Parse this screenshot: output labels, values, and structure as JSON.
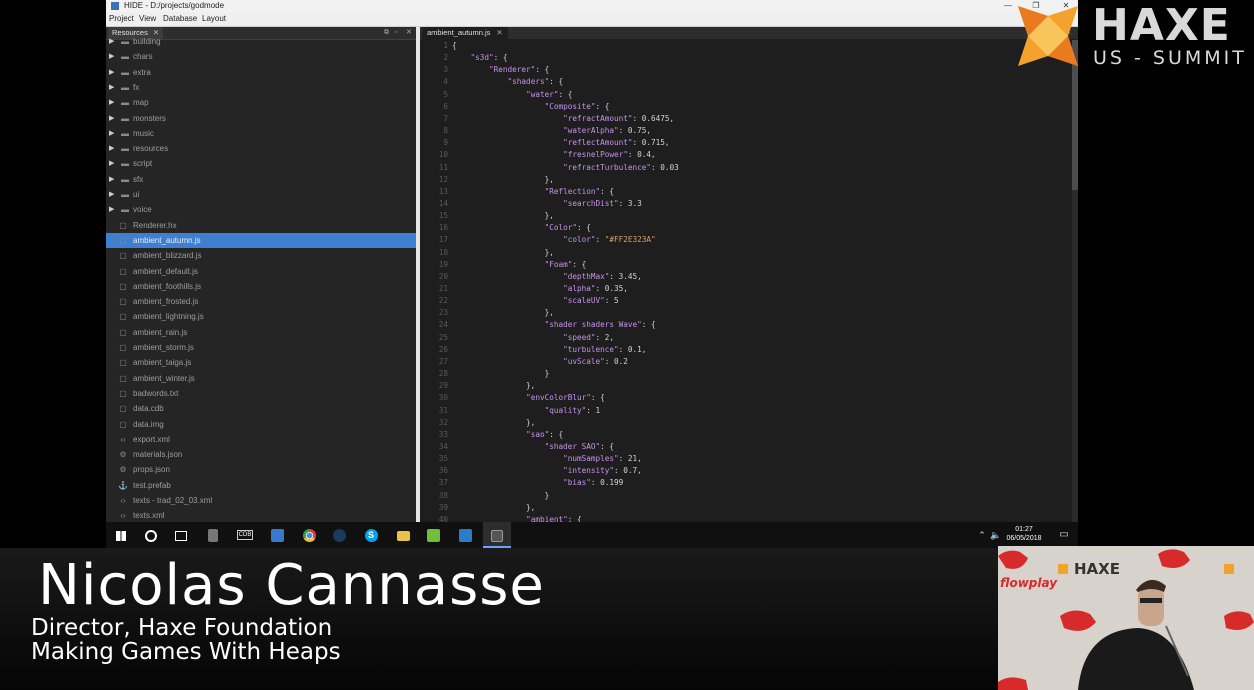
{
  "window": {
    "title": "HIDE - D:/projects/godmode",
    "controls": [
      "—",
      "❐",
      "✕"
    ]
  },
  "menu": [
    "Project",
    "View",
    "Database",
    "Layout"
  ],
  "resources_panel": {
    "tab_label": "Resources",
    "items": [
      {
        "label": "building",
        "type": "folder"
      },
      {
        "label": "chars",
        "type": "folder"
      },
      {
        "label": "extra",
        "type": "folder"
      },
      {
        "label": "fx",
        "type": "folder"
      },
      {
        "label": "map",
        "type": "folder"
      },
      {
        "label": "monsters",
        "type": "folder"
      },
      {
        "label": "music",
        "type": "folder"
      },
      {
        "label": "resources",
        "type": "folder"
      },
      {
        "label": "script",
        "type": "folder"
      },
      {
        "label": "sfx",
        "type": "folder"
      },
      {
        "label": "ui",
        "type": "folder"
      },
      {
        "label": "voice",
        "type": "folder"
      },
      {
        "label": "Renderer.hx",
        "type": "file"
      },
      {
        "label": "ambient_autumn.js",
        "type": "file",
        "selected": true
      },
      {
        "label": "ambient_blizzard.js",
        "type": "file"
      },
      {
        "label": "ambient_default.js",
        "type": "file"
      },
      {
        "label": "ambient_foothills.js",
        "type": "file"
      },
      {
        "label": "ambient_frosted.js",
        "type": "file"
      },
      {
        "label": "ambient_lightning.js",
        "type": "file"
      },
      {
        "label": "ambient_rain.js",
        "type": "file"
      },
      {
        "label": "ambient_storm.js",
        "type": "file"
      },
      {
        "label": "ambient_taiga.js",
        "type": "file"
      },
      {
        "label": "ambient_winter.js",
        "type": "file"
      },
      {
        "label": "badwords.txt",
        "type": "file"
      },
      {
        "label": "data.cdb",
        "type": "file"
      },
      {
        "label": "data.img",
        "type": "file"
      },
      {
        "label": "export.xml",
        "type": "xml"
      },
      {
        "label": "materials.json",
        "type": "json"
      },
      {
        "label": "props.json",
        "type": "json"
      },
      {
        "label": "test.prefab",
        "type": "prefab"
      },
      {
        "label": "texts - trad_02_03.xml",
        "type": "xml"
      },
      {
        "label": "texts.xml",
        "type": "xml"
      }
    ]
  },
  "editor": {
    "tab_label": "ambient_autumn.js",
    "lines": [
      "{",
      "    \"s3d\": {",
      "        \"Renderer\": {",
      "            \"shaders\": {",
      "                \"water\": {",
      "                    \"Composite\": {",
      "                        \"refractAmount\": 0.6475,",
      "                        \"waterAlpha\": 0.75,",
      "                        \"reflectAmount\": 0.715,",
      "                        \"fresnelPower\": 0.4,",
      "                        \"refractTurbulence\": 0.03",
      "                    },",
      "                    \"Reflection\": {",
      "                        \"searchDist\": 3.3",
      "                    },",
      "                    \"Color\": {",
      "                        \"color\": \"#FF2E323A\"",
      "                    },",
      "                    \"Foam\": {",
      "                        \"depthMax\": 3.45,",
      "                        \"alpha\": 0.35,",
      "                        \"scaleUV\": 5",
      "                    },",
      "                    \"shader shaders Wave\": {",
      "                        \"speed\": 2,",
      "                        \"turbulence\": 0.1,",
      "                        \"uvScale\": 0.2",
      "                    }",
      "                },",
      "                \"envColorBlur\": {",
      "                    \"quality\": 1",
      "                },",
      "                \"sao\": {",
      "                    \"shader SAO\": {",
      "                        \"numSamples\": 21,",
      "                        \"intensity\": 0.7,",
      "                        \"bias\": 0.199",
      "                    }",
      "                },",
      "                \"ambient\": {"
    ]
  },
  "taskbar": {
    "apps": [
      "start",
      "cortana",
      "task-view",
      "calculator",
      "cdb",
      "app-blue",
      "chrome",
      "steam",
      "skype",
      "explorer",
      "notepad",
      "vscode",
      "hide"
    ],
    "cdb_label": "CDB",
    "time": "01:27",
    "date": "06/05/2018"
  },
  "branding": {
    "event_title": "HAXE",
    "event_subtitle": "US - SUMMIT"
  },
  "lower_third": {
    "name": "Nicolas Cannasse",
    "role": "Director, Haxe Foundation",
    "talk": "Making Games With Heaps"
  },
  "camera": {
    "wall_logos": [
      "HAXE",
      "flowplay"
    ]
  },
  "colors": {
    "selection": "#3f7fcf",
    "editor_bg": "#1e1e1e",
    "haxe_orange": "#f3a32d"
  }
}
